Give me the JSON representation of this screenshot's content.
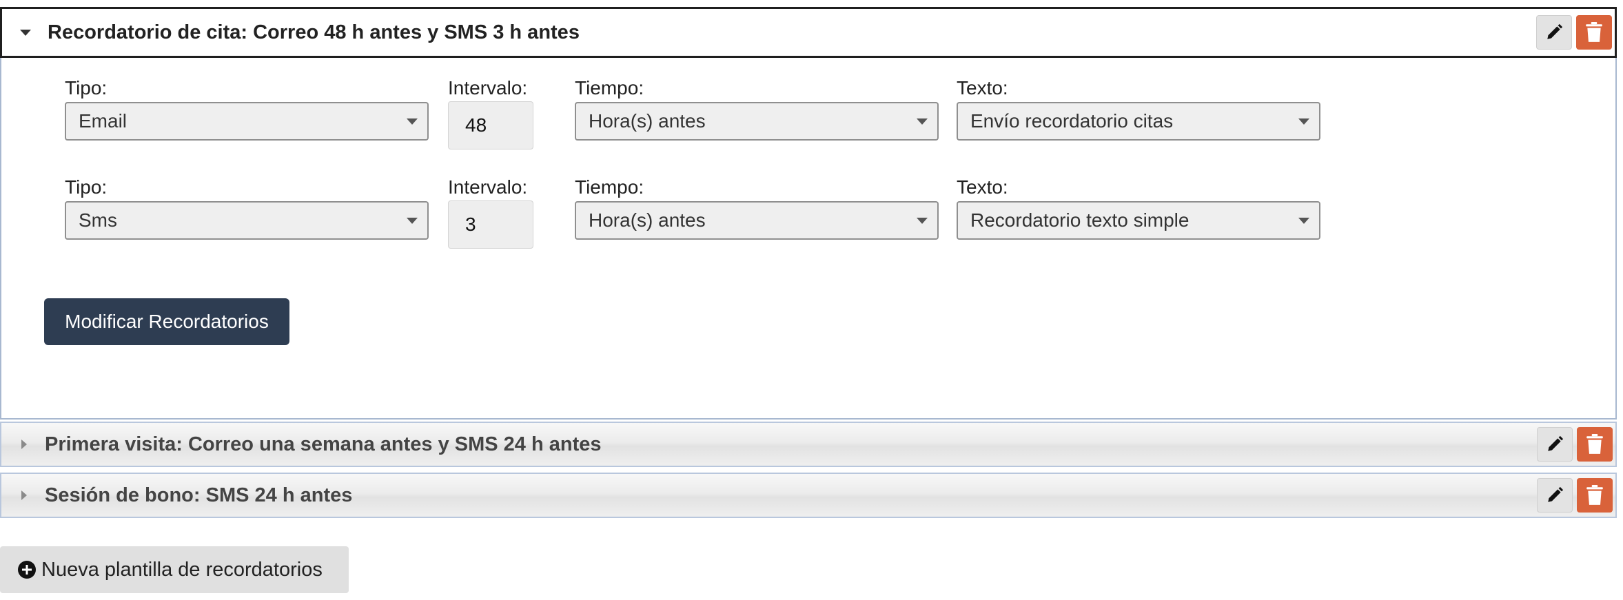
{
  "templates": [
    {
      "title": "Recordatorio de cita: Correo 48 h antes y SMS 3 h antes",
      "expanded": true,
      "rows": [
        {
          "tipo_label": "Tipo:",
          "tipo_value": "Email",
          "intervalo_label": "Intervalo:",
          "intervalo_value": "48",
          "tiempo_label": "Tiempo:",
          "tiempo_value": "Hora(s) antes",
          "texto_label": "Texto:",
          "texto_value": "Envío recordatorio citas"
        },
        {
          "tipo_label": "Tipo:",
          "tipo_value": "Sms",
          "intervalo_label": "Intervalo:",
          "intervalo_value": "3",
          "tiempo_label": "Tiempo:",
          "tiempo_value": "Hora(s) antes",
          "texto_label": "Texto:",
          "texto_value": "Recordatorio texto simple"
        }
      ],
      "submit_label": "Modificar Recordatorios"
    },
    {
      "title": "Primera visita: Correo una semana antes y SMS 24 h antes",
      "expanded": false
    },
    {
      "title": "Sesión de bono: SMS 24 h antes",
      "expanded": false
    }
  ],
  "new_template_label": "Nueva plantilla de recordatorios",
  "icons": {
    "edit": "pencil-icon",
    "delete": "trash-icon",
    "add": "plus-circle-icon",
    "expanded": "caret-down-icon",
    "collapsed": "caret-right-icon"
  },
  "colors": {
    "delete_button": "#d9623a",
    "primary_button": "#2e3d52",
    "edit_button": "#e3e3e3"
  }
}
